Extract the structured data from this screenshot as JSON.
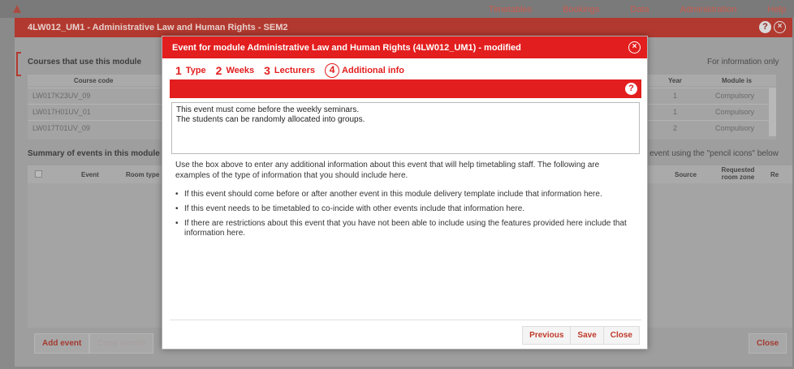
{
  "topnav": [
    "Timetables",
    "Bookings",
    "Data",
    "Administration",
    "Help"
  ],
  "background": {
    "title": "4LW012_UM1 - Administrative Law and Human Rights - SEM2",
    "courses_heading": "Courses that use this module",
    "info_only": "For information only",
    "courses_table": {
      "headers": [
        "Course code",
        "Year",
        "Module is"
      ],
      "rows": [
        {
          "code": "LW017K23UV_09",
          "year": "1",
          "module_is": "Compulsory"
        },
        {
          "code": "LW017H01UV_01",
          "year": "1",
          "module_is": "Compulsory"
        },
        {
          "code": "LW017T01UV_09",
          "year": "2",
          "module_is": "Compulsory"
        }
      ]
    },
    "summary_heading": "Summary of events in this module d",
    "summary_hint": "event using the \"pencil icons\" below",
    "events_headers": [
      "Event",
      "Room type",
      "Source",
      "Requested room zone",
      "Re"
    ],
    "add_event": "Add event",
    "copy_events": "Copy events",
    "close": "Close"
  },
  "modal": {
    "title": "Event for module Administrative Law and Human Rights (4LW012_UM1) - modified",
    "steps": [
      {
        "num": "1",
        "label": "Type"
      },
      {
        "num": "2",
        "label": "Weeks"
      },
      {
        "num": "3",
        "label": "Lecturers"
      },
      {
        "num": "4",
        "label": "Additional info"
      }
    ],
    "textarea_value": "This event must come before the weekly seminars.\nThe students can be randomly allocated into groups.",
    "intro": "Use the box above to enter any additional information about this event that will help timetabling staff. The following are examples of the type of information that you should include here.",
    "bullets": [
      "If this event should come before or after another event in this module delivery template include that information here.",
      "If this event needs to be timetabled to co-incide with other events include that information here.",
      "If there are restrictions about this event that you have not been able to include using the features provided here include that information here."
    ],
    "previous": "Previous",
    "save": "Save",
    "close": "Close"
  }
}
